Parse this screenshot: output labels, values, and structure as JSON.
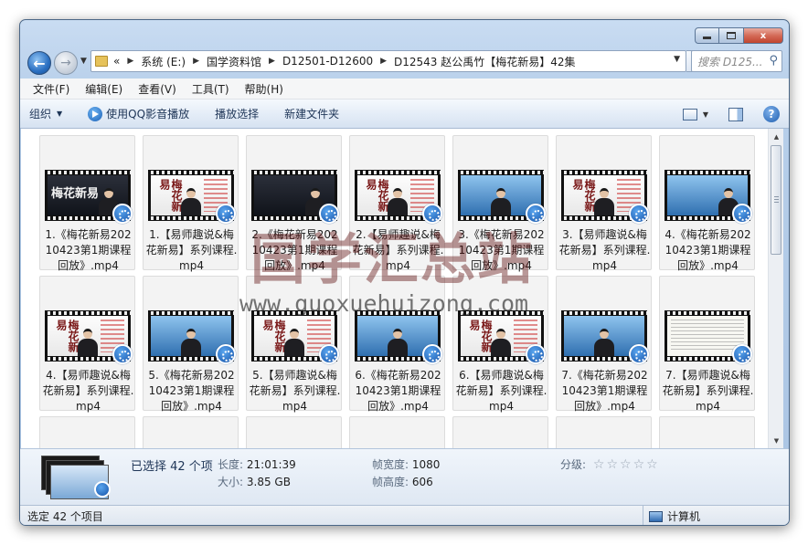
{
  "window": {
    "caption_buttons": {
      "minimize": "—",
      "maximize": "□",
      "close": "x"
    }
  },
  "navigation": {
    "back_icon": "arrow-left-icon",
    "forward_icon": "arrow-right-icon",
    "breadcrumb_overflow": "«",
    "breadcrumbs": [
      "系统 (E:)",
      "国学资料馆",
      "D12501-D12600",
      "D12543 赵公禹竹【梅花新易】42集"
    ],
    "search_placeholder": "搜索 D125..."
  },
  "menu": {
    "items": [
      "文件(F)",
      "编辑(E)",
      "查看(V)",
      "工具(T)",
      "帮助(H)"
    ]
  },
  "commands": {
    "organize": "组织",
    "play_qq": "使用QQ影音播放",
    "play_selection": "播放选择",
    "new_folder": "新建文件夹"
  },
  "files": [
    {
      "name": "1.《梅花新易20210423第1期课程回放》.mp4",
      "thumb": "calligraphy"
    },
    {
      "name": "1.【易师趣说&梅花新易】系列课程.mp4",
      "thumb": "white"
    },
    {
      "name": "2.《梅花新易20210423第1期课程回放》.mp4",
      "thumb": "dark"
    },
    {
      "name": "2.【易师趣说&梅花新易】系列课程.mp4",
      "thumb": "white"
    },
    {
      "name": "3.《梅花新易20210423第1期课程回放》.mp4",
      "thumb": "blue"
    },
    {
      "name": "3.【易师趣说&梅花新易】系列课程.mp4",
      "thumb": "white"
    },
    {
      "name": "4.《梅花新易20210423第1期课程回放》.mp4",
      "thumb": "blue-right"
    },
    {
      "name": "4.【易师趣说&梅花新易】系列课程.mp4",
      "thumb": "white"
    },
    {
      "name": "5.《梅花新易20210423第1期课程回放》.mp4",
      "thumb": "blue"
    },
    {
      "name": "5.【易师趣说&梅花新易】系列课程.mp4",
      "thumb": "white"
    },
    {
      "name": "6.《梅花新易20210423第1期课程回放》.mp4",
      "thumb": "blue"
    },
    {
      "name": "6.【易师趣说&梅花新易】系列课程.mp4",
      "thumb": "white"
    },
    {
      "name": "7.《梅花新易20210423第1期课程回放》.mp4",
      "thumb": "blue"
    },
    {
      "name": "7.【易师趣说&梅花新易】系列课程.mp4",
      "thumb": "doc"
    },
    {
      "name": "",
      "thumb": "dark"
    },
    {
      "name": "",
      "thumb": "dark"
    },
    {
      "name": "",
      "thumb": "dark"
    },
    {
      "name": "",
      "thumb": "dark"
    },
    {
      "name": "",
      "thumb": "dark"
    },
    {
      "name": "",
      "thumb": "dark"
    },
    {
      "name": "",
      "thumb": "dark"
    }
  ],
  "thumb_text": {
    "calligraphy": "梅花新易",
    "vertical": "梅花新易"
  },
  "details": {
    "selected": "已选择 42 个项",
    "length_label": "长度:",
    "length_value": "21:01:39",
    "size_label": "大小:",
    "size_value": "3.85 GB",
    "frame_width_label": "帧宽度:",
    "frame_width_value": "1080",
    "frame_height_label": "帧高度:",
    "frame_height_value": "606",
    "rating_label": "分级:",
    "rating_stars": 0,
    "rating_max": 5
  },
  "status": {
    "selected_count": "选定 42 个项目",
    "location": "计算机"
  },
  "watermark": {
    "title": "国学汇总站",
    "url": "www.guoxuehuizong.com"
  }
}
